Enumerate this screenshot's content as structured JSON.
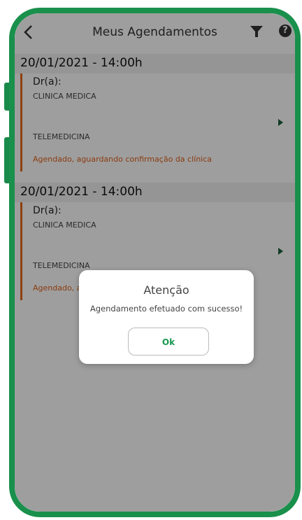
{
  "header": {
    "title": "Meus Agendamentos",
    "back_icon": "chevron-left-icon",
    "filter_icon": "filter-icon",
    "help_icon": "help-circle-icon",
    "help_glyph": "?"
  },
  "appointments": [
    {
      "date": "20/01/2021 - 14:00h",
      "doctor": "Dr(a):",
      "specialty": "CLINICA MEDICA",
      "modality": "TELEMEDICINA",
      "status": "Agendado, aguardando confirmação da clínica"
    },
    {
      "date": "20/01/2021 - 14:00h",
      "doctor": "Dr(a):",
      "specialty": "CLINICA MEDICA",
      "modality": "TELEMEDICINA",
      "status": "Agendado, aguardando confirmação da clínica"
    }
  ],
  "dialog": {
    "title": "Atenção",
    "message": "Agendamento efetuado com sucesso!",
    "ok_label": "Ok"
  },
  "colors": {
    "brand_green": "#19904b",
    "status_orange": "#e0611a"
  }
}
